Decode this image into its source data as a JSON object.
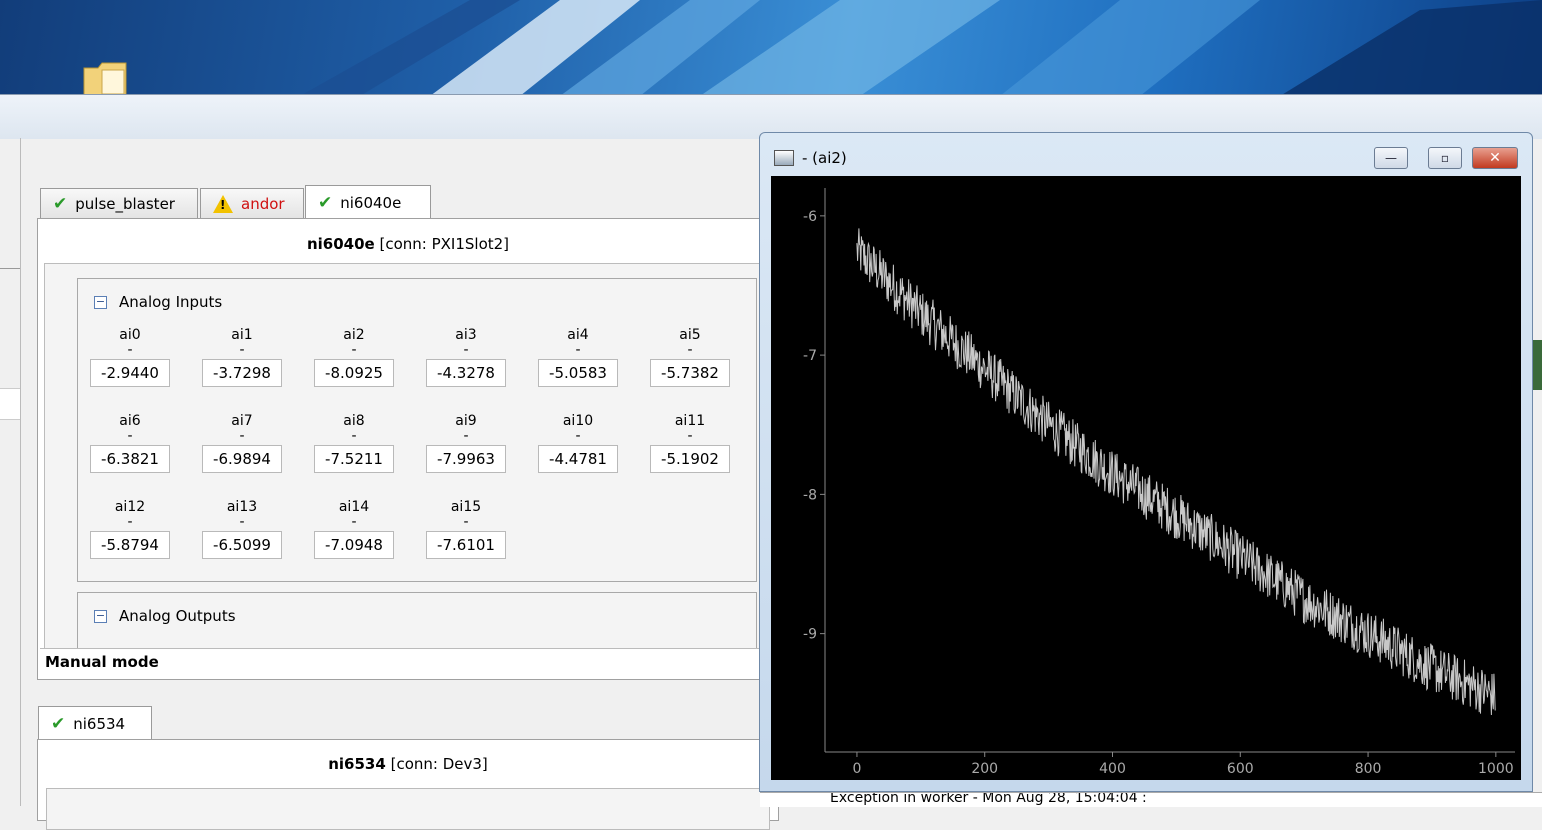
{
  "device_tabs": [
    {
      "label": "pulse_blaster",
      "status": "ok"
    },
    {
      "label": "andor",
      "status": "warning"
    },
    {
      "label": "ni6040e",
      "status": "ok",
      "active": true
    }
  ],
  "device_panel": {
    "name": "ni6040e",
    "conn": "[conn: PXI1Slot2]",
    "analog_inputs_label": "Analog Inputs",
    "analog_outputs_label": "Analog Outputs",
    "unit_dash": "-",
    "channels": [
      {
        "name": "ai0",
        "value": "-2.9440"
      },
      {
        "name": "ai1",
        "value": "-3.7298"
      },
      {
        "name": "ai2",
        "value": "-8.0925"
      },
      {
        "name": "ai3",
        "value": "-4.3278"
      },
      {
        "name": "ai4",
        "value": "-5.0583"
      },
      {
        "name": "ai5",
        "value": "-5.7382"
      },
      {
        "name": "ai6",
        "value": "-6.3821"
      },
      {
        "name": "ai7",
        "value": "-6.9894"
      },
      {
        "name": "ai8",
        "value": "-7.5211"
      },
      {
        "name": "ai9",
        "value": "-7.9963"
      },
      {
        "name": "ai10",
        "value": "-4.4781"
      },
      {
        "name": "ai11",
        "value": "-5.1902"
      },
      {
        "name": "ai12",
        "value": "-5.8794"
      },
      {
        "name": "ai13",
        "value": "-6.5099"
      },
      {
        "name": "ai14",
        "value": "-7.0948"
      },
      {
        "name": "ai15",
        "value": "-7.6101"
      }
    ],
    "manual_mode": "Manual mode"
  },
  "second_device": {
    "tab_label": "ni6534",
    "name": "ni6534",
    "conn": "[conn: Dev3]"
  },
  "plot_window": {
    "title": "- (ai2)",
    "minimize": "—",
    "restore": "▫",
    "close": "✕"
  },
  "chart_data": {
    "type": "line",
    "title": "",
    "xlabel": "",
    "ylabel": "",
    "xlim": [
      -50,
      1030
    ],
    "ylim": [
      -9.85,
      -5.8
    ],
    "x_ticks": [
      "0",
      "200",
      "400",
      "600",
      "800",
      "1000"
    ],
    "x_tick_values": [
      0,
      200,
      400,
      600,
      800,
      1000
    ],
    "y_ticks": [
      "-6",
      "-7",
      "-8",
      "-9"
    ],
    "y_tick_values": [
      -6,
      -7,
      -8,
      -9
    ],
    "series": [
      {
        "trend_x": [
          0,
          100,
          200,
          300,
          400,
          500,
          600,
          700,
          800,
          900,
          1000
        ],
        "trend_y": [
          -6.25,
          -6.7,
          -7.1,
          -7.5,
          -7.85,
          -8.15,
          -8.45,
          -8.75,
          -9.0,
          -9.25,
          -9.45
        ],
        "noise_amplitude": 0.35,
        "n_points": 1000,
        "color": "#c8c8c8"
      }
    ],
    "background": "#000000",
    "axis_color": "#888888"
  },
  "console": {
    "message": "Exception in worker - Mon Aug 28, 15:04:04 :"
  }
}
